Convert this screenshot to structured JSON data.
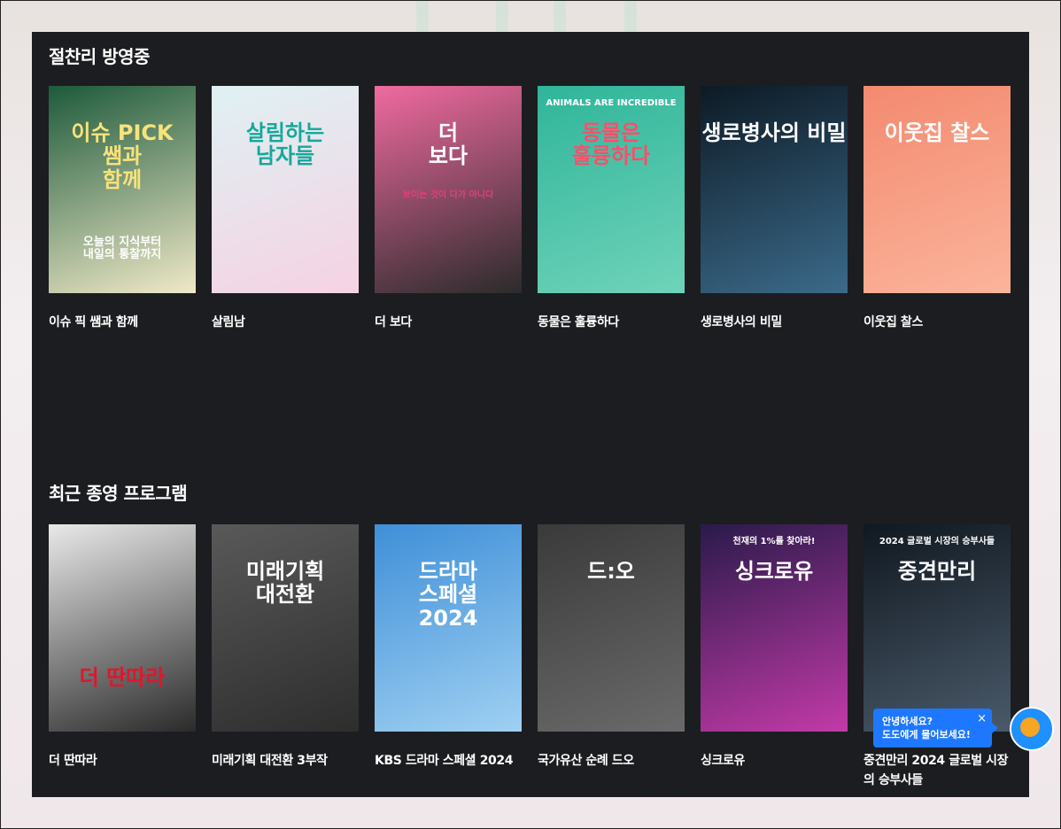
{
  "sections": [
    {
      "title": "절찬리 방영중",
      "items": [
        {
          "label": "이슈 픽 쌤과 함께",
          "poster_text": "이슈 PICK\n쌤과\n함께",
          "sub": "오늘의 지식부터\n내일의 통찰까지",
          "colors": [
            "#1d5a3b",
            "#f0e9c8"
          ]
        },
        {
          "label": "살림남",
          "poster_text": "살림하는\n남자들",
          "sub": "",
          "colors": [
            "#dff1f3",
            "#f6d2e4"
          ]
        },
        {
          "label": "더 보다",
          "poster_text": "더\n보다",
          "sub": "보이는 것이 다가 아니다",
          "colors": [
            "#f06aa0",
            "#2b2b2b"
          ]
        },
        {
          "label": "동물은 훌륭하다",
          "poster_text": "동물은\n훌륭하다",
          "sub": "ANIMALS ARE INCREDIBLE",
          "colors": [
            "#2fb59a",
            "#6fd3b9"
          ]
        },
        {
          "label": "생로병사의 비밀",
          "poster_text": "생로병사의 비밀",
          "sub": "",
          "colors": [
            "#0d1a25",
            "#3b6a8a"
          ]
        },
        {
          "label": "이웃집 찰스",
          "poster_text": "이웃집 찰스",
          "sub": "",
          "colors": [
            "#f38a70",
            "#fbb49b"
          ]
        }
      ]
    },
    {
      "title": "최근 종영 프로그램",
      "items": [
        {
          "label": "더 딴따라",
          "poster_text": "더 딴따라",
          "sub": "",
          "colors": [
            "#e9e9e9",
            "#2a2a2a"
          ]
        },
        {
          "label": "미래기획 대전환 3부작",
          "poster_text": "미래기획\n대전환",
          "sub": "",
          "colors": [
            "#595959",
            "#2d2d2d"
          ]
        },
        {
          "label": "KBS 드라마 스페셜 2024",
          "poster_text": "드라마\n스페셜\n2024",
          "sub": "",
          "colors": [
            "#3f8fd8",
            "#9fd0f2"
          ]
        },
        {
          "label": "국가유산 순례 드오",
          "poster_text": "드:오",
          "sub": "",
          "colors": [
            "#3a3a3a",
            "#6a6a6a"
          ]
        },
        {
          "label": "싱크로유",
          "poster_text": "싱크로유",
          "sub": "천재의 1%를 찾아라!",
          "colors": [
            "#2a1a4a",
            "#c23aa8"
          ]
        },
        {
          "label": "중견만리 2024 글로벌 시장의 승부사들",
          "poster_text": "중견만리",
          "sub": "2024 글로벌 시장의 승부사들",
          "colors": [
            "#101820",
            "#4a5a6a"
          ]
        }
      ]
    }
  ],
  "chat": {
    "line1": "안녕하세요?",
    "line2": "도도에게 물어보세요!",
    "close": "×"
  }
}
